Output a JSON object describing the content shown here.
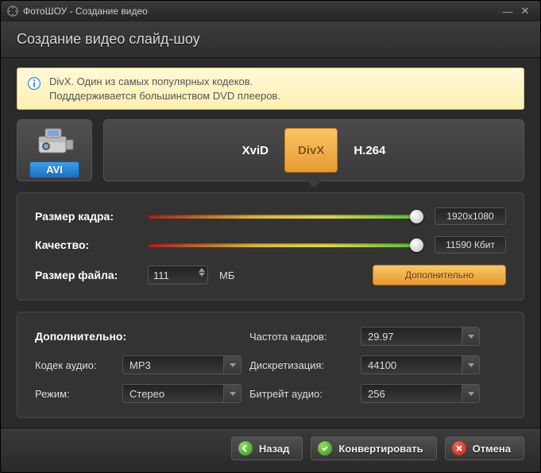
{
  "window": {
    "title": "ФотоШОУ - Создание видео"
  },
  "header": {
    "title": "Создание видео слайд-шоу"
  },
  "info": {
    "line1": "DivX. Один из самых популярных кодеков.",
    "line2": "Подддерживается большинством DVD плееров."
  },
  "format": {
    "avi_label": "AVI",
    "codecs": [
      "XviD",
      "DivX",
      "H.264"
    ],
    "selected": "DivX"
  },
  "sliders": {
    "frame_size": {
      "label": "Размер кадра:",
      "value": "1920x1080"
    },
    "quality": {
      "label": "Качество:",
      "value": "11590 Кбит"
    }
  },
  "file_size": {
    "label": "Размер файла:",
    "value": "111",
    "unit": "МБ"
  },
  "advanced_btn": "Дополнительно",
  "advanced": {
    "title": "Дополнительно:",
    "audio_codec": {
      "label": "Кодек аудио:",
      "value": "MP3"
    },
    "mode": {
      "label": "Режим:",
      "value": "Стерео"
    },
    "fps": {
      "label": "Частота кадров:",
      "value": "29.97"
    },
    "sample_rate": {
      "label": "Дискретизация:",
      "value": "44100"
    },
    "audio_bitrate": {
      "label": "Битрейт аудио:",
      "value": "256"
    }
  },
  "footer": {
    "back": "Назад",
    "convert": "Конвертировать",
    "cancel": "Отмена"
  }
}
